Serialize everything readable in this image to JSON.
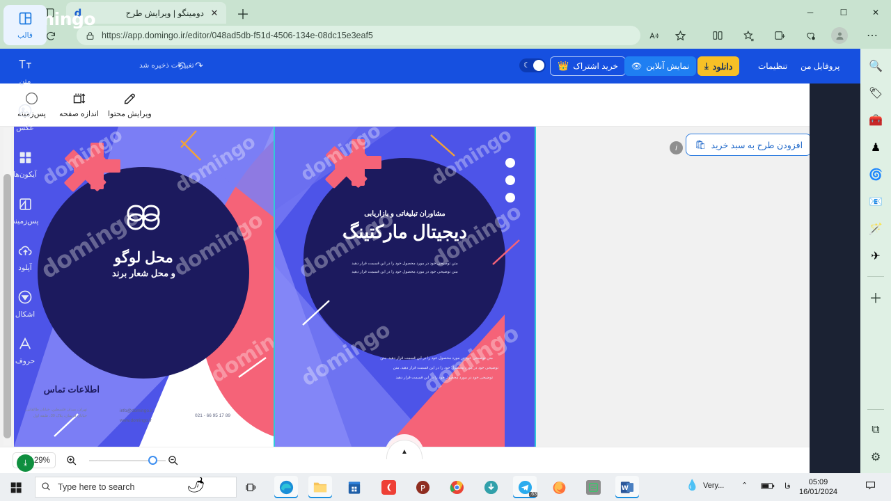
{
  "browser": {
    "tab": {
      "title": "دومینگو | ویرایش طرح",
      "favicon": "d",
      "close_icon": "✕"
    },
    "newtab_icon": "＋",
    "back_icon": "←",
    "reload_icon": "⟳",
    "url": "https://app.domingo.ir/editor/048ad5db-f51d-4506-134e-08dc15e3eaf5",
    "url_host": "app.domingo.ir",
    "lock_icon": "lock-icon",
    "read_aloud_icon": "A",
    "favorite_icon": "☆",
    "split_icon": "⫿⫾",
    "favorites_icon": "☆",
    "collections_icon": "⊞",
    "essentials_icon": "♡",
    "settings_icon": "⋯",
    "minimize_icon": "─",
    "maximize_icon": "☐",
    "close_icon": "✕"
  },
  "edge_sidebar": {
    "items": [
      {
        "name": "search-icon",
        "glyph": "🔍"
      },
      {
        "name": "shopping-icon",
        "glyph": "🏷"
      },
      {
        "name": "tools-icon",
        "glyph": "🧰"
      },
      {
        "name": "games-icon",
        "glyph": "♟"
      },
      {
        "name": "office-icon",
        "glyph": "🌀"
      },
      {
        "name": "outlook-icon",
        "glyph": "📧"
      },
      {
        "name": "designer-icon",
        "glyph": "🪄"
      },
      {
        "name": "telegram-icon",
        "glyph": "✈"
      }
    ],
    "add_icon": "＋",
    "open-in-new-icon": "⧉",
    "settings_icon": "⚙"
  },
  "app_header": {
    "logo": "domingo",
    "saved_text": "تغییرات ذخیره شد",
    "undo_icon": "↶",
    "redo_icon": "↷",
    "theme_toggle": {
      "name": "dark-mode-toggle",
      "state": "on",
      "moon_icon": "☾"
    },
    "subscribe_button": {
      "label": "خرید اشتراک",
      "icon": "👑"
    },
    "preview_button": {
      "label": "نمایش آنلاین",
      "icon": "👁"
    },
    "download_button": {
      "label": "دانلود",
      "icon": "⤓"
    },
    "settings_link": "تنظیمات",
    "profile_link": "پروفایل من"
  },
  "app_toolbar": {
    "items": [
      {
        "label": "ویرایش محتوا",
        "icon": "pencil-icon"
      },
      {
        "label": "اندازه صفحه",
        "icon": "resize-icon"
      },
      {
        "label": "پس‌زمینه",
        "icon": "circle-icon"
      }
    ]
  },
  "canvas": {
    "cart_button": {
      "label": "افزودن طرح به سبد خرید",
      "icon": "🛍"
    },
    "info_badge": "i",
    "collapse_icon": "▲",
    "watermark_text": "domingo",
    "pages": [
      {
        "name": "page-left",
        "logo_placeholder": "محل لوگو",
        "slogan_placeholder": "و محل شعار برند",
        "contact_heading": "اطلاعات تماس",
        "address": "تهران، میدان فلسطین، خیابان طالقانی، خیابان فریمان، پلاک 30، طبقه اول",
        "email": "info@domingo.ir",
        "website": "www.domingo.ir",
        "phone": "021 - 66 95 17 89"
      },
      {
        "name": "page-right",
        "subtitle": "مشاوران تبلیغاتی و بازاریابی",
        "title": "دیجیتال مارکتینگ",
        "body_line1": "متن توضیحی خود در مورد محصول خود را در این قسمت قرار دهید",
        "body_line2": "متن توضیحی خود در مورد محصول خود را در این قسمت قرار دهید",
        "footer_line1": "متن توضیحی خود در مورد محصول خود را در این قسمت قرار دهید. متن",
        "footer_line2": "توضیحی خود در مورد محصول خود را در این قسمت قرار دهید. متن",
        "footer_line3": "توضیحی خود در مورد محصول خود را در این قسمت قرار دهید"
      }
    ]
  },
  "zoombar": {
    "zoom_level": "29%",
    "chevron_icon": "⌄",
    "zoom_in_icon": "zoom-in-icon",
    "zoom_out_icon": "zoom-out-icon"
  },
  "rail": {
    "items": [
      {
        "label": "قالب",
        "icon": "template-icon",
        "active": true
      },
      {
        "label": "متن",
        "icon": "text-icon",
        "active": false
      },
      {
        "label": "عکس",
        "icon": "image-icon",
        "active": false
      },
      {
        "label": "آیکون‌ها",
        "icon": "icons-grid-icon",
        "active": false
      },
      {
        "label": "پس‌زمینه",
        "icon": "background-icon",
        "active": false
      },
      {
        "label": "آپلود",
        "icon": "upload-cloud-icon",
        "active": false
      },
      {
        "label": "اشکال",
        "icon": "shapes-icon",
        "active": false
      },
      {
        "label": "حروف",
        "icon": "letters-icon",
        "active": false
      }
    ],
    "download_fab_icon": "⤓"
  },
  "taskbar": {
    "start_icon": "windows-icon",
    "search_placeholder": "Type here to search",
    "search_icon": "🔍",
    "chili_icon": "🌶",
    "taskview_icon": "⧉",
    "apps": [
      {
        "name": "edge-icon",
        "glyph": "e",
        "active": true
      },
      {
        "name": "file-explorer-icon",
        "glyph": "📁",
        "active": true
      },
      {
        "name": "microsoft-store-icon",
        "glyph": "🛍",
        "active": false
      },
      {
        "name": "camtasia-icon",
        "glyph": "C",
        "active": false
      },
      {
        "name": "potplayer-icon",
        "glyph": "P",
        "active": false
      },
      {
        "name": "chrome-icon",
        "glyph": "◎",
        "active": false
      },
      {
        "name": "idm-icon",
        "glyph": "⇩",
        "active": false
      },
      {
        "name": "telegram-icon",
        "glyph": "✈",
        "active": true,
        "badge": ".63"
      },
      {
        "name": "firefox-icon",
        "glyph": "🦊",
        "active": false
      },
      {
        "name": "notes-icon",
        "glyph": "▤",
        "active": false
      },
      {
        "name": "word-icon",
        "glyph": "W",
        "active": true
      }
    ],
    "weather": "Very...",
    "weather_icon": "💧",
    "overflow_icon": "⌃",
    "battery_icon": "🔋",
    "language": "فا",
    "time": "05:09",
    "date": "16/01/2024",
    "notification_icon": "💬"
  },
  "colors": {
    "brand_blue": "#1650e0",
    "accent_yellow": "#f7c026",
    "page_blue": "#4d54e8",
    "page_navy": "#1c1a5e",
    "page_coral": "#f56378",
    "rail_dark": "#1b2233"
  }
}
